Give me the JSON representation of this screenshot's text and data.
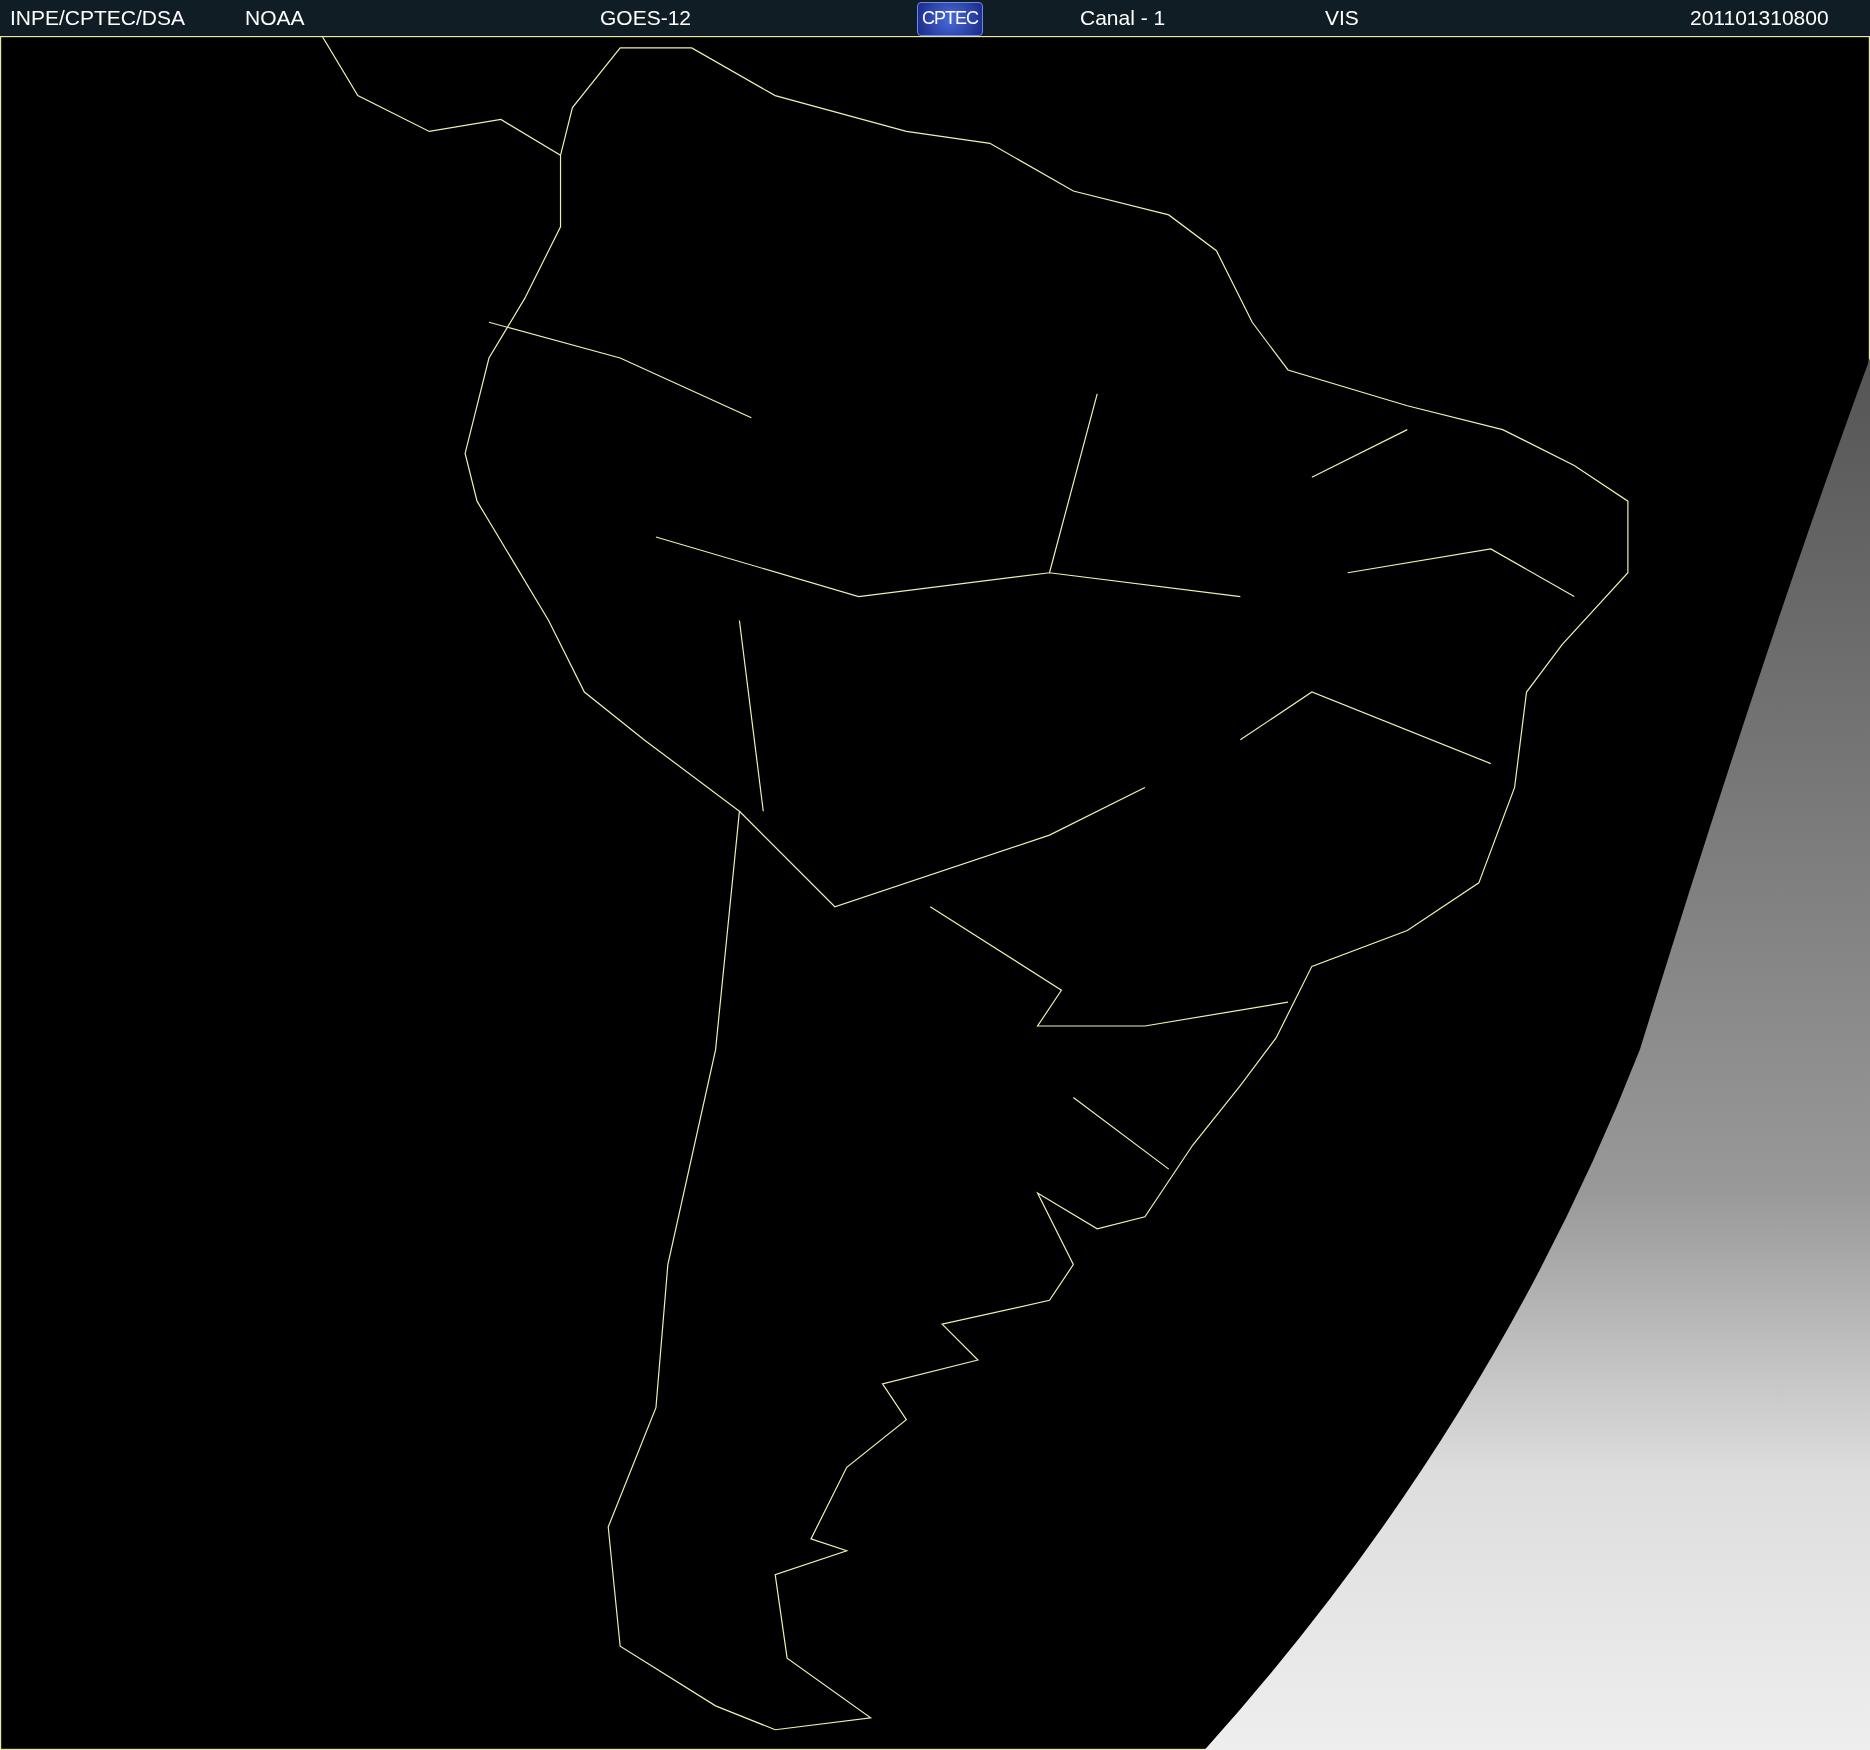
{
  "header": {
    "agency": "INPE/CPTEC/DSA",
    "source": "NOAA",
    "satellite": "GOES-12",
    "logo_text": "CPTEC",
    "channel": "Canal - 1",
    "band": "VIS",
    "timestamp": "201101310800"
  }
}
